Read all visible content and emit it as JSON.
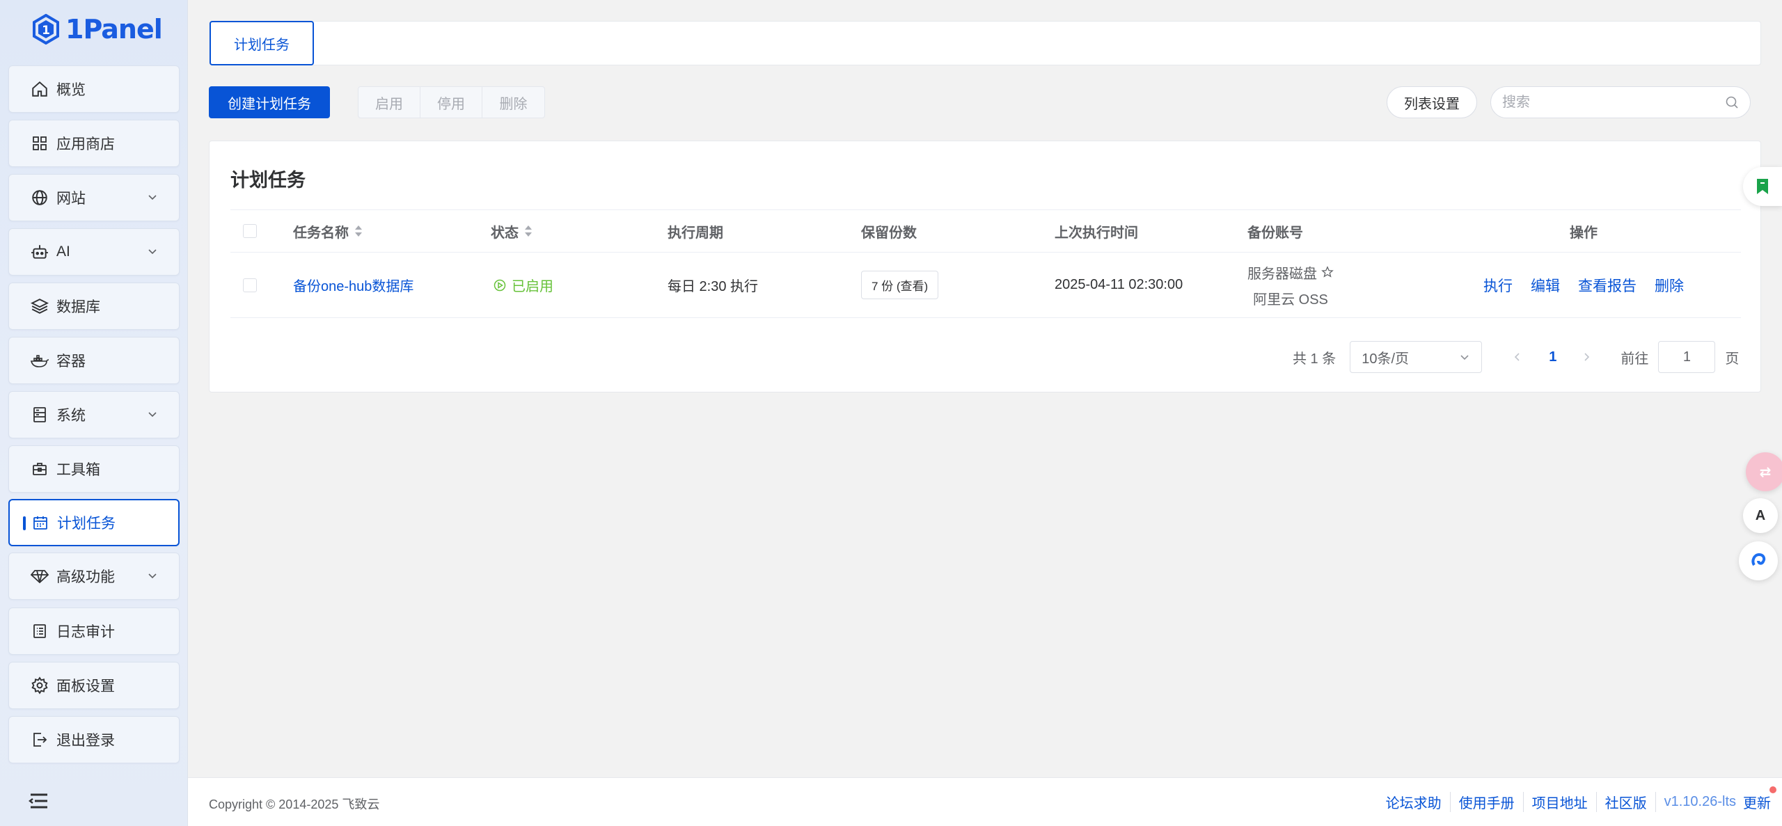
{
  "app": {
    "logo_text": "1Panel"
  },
  "sidebar": {
    "items": [
      {
        "label": "概览",
        "icon": "home-icon"
      },
      {
        "label": "应用商店",
        "icon": "grid-icon"
      },
      {
        "label": "网站",
        "icon": "globe-icon"
      },
      {
        "label": "AI",
        "icon": "robot-icon"
      },
      {
        "label": "数据库",
        "icon": "layers-icon"
      },
      {
        "label": "容器",
        "icon": "docker-icon"
      },
      {
        "label": "系统",
        "icon": "server-icon"
      },
      {
        "label": "工具箱",
        "icon": "toolbox-icon"
      },
      {
        "label": "计划任务",
        "icon": "calendar-icon",
        "active": true
      },
      {
        "label": "高级功能",
        "icon": "diamond-icon"
      },
      {
        "label": "日志审计",
        "icon": "log-icon"
      },
      {
        "label": "面板设置",
        "icon": "gear-icon"
      },
      {
        "label": "退出登录",
        "icon": "logout-icon"
      }
    ]
  },
  "tabs": {
    "active": "计划任务"
  },
  "toolbar": {
    "create": "创建计划任务",
    "enable": "启用",
    "disable": "停用",
    "delete": "删除",
    "column_settings": "列表设置",
    "search_placeholder": "搜索"
  },
  "card": {
    "title": "计划任务"
  },
  "table": {
    "headers": {
      "name": "任务名称",
      "status": "状态",
      "cycle": "执行周期",
      "retain": "保留份数",
      "last_run": "上次执行时间",
      "backup_account": "备份账号",
      "ops": "操作"
    },
    "rows": [
      {
        "name": "备份one-hub数据库",
        "status": "已启用",
        "cycle": "每日 2:30 执行",
        "retain": "7 份 (查看)",
        "last_run": "2025-04-11 02:30:00",
        "account_1": "服务器磁盘",
        "account_2": "阿里云 OSS",
        "ops": [
          "执行",
          "编辑",
          "查看报告",
          "删除"
        ]
      }
    ]
  },
  "pagination": {
    "total": "共 1 条",
    "page_size": "10条/页",
    "current": "1",
    "goto_label": "前往",
    "goto_value": "1",
    "page_suffix": "页"
  },
  "footer": {
    "copyright": "Copyright © 2014-2025 飞致云",
    "links": [
      "论坛求助",
      "使用手册",
      "项目地址",
      "社区版"
    ],
    "version": "v1.10.26-lts",
    "update": "更新"
  },
  "colors": {
    "primary": "#0854d6",
    "success": "#67c23a",
    "sidebar_bg": "#e4ebf7"
  }
}
